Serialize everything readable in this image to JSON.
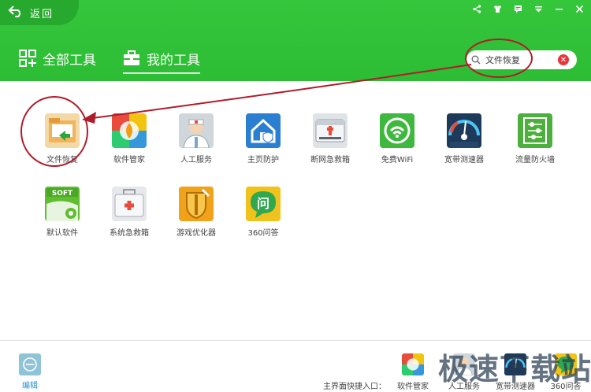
{
  "header": {
    "back_label": "返回",
    "tabs": [
      {
        "label": "全部工具",
        "active": false
      },
      {
        "label": "我的工具",
        "active": true
      }
    ],
    "search_value": "文件恢复"
  },
  "tools": [
    {
      "label": "文件恢复",
      "icon": "file-recovery-icon"
    },
    {
      "label": "软件管家",
      "icon": "software-manager-icon"
    },
    {
      "label": "人工服务",
      "icon": "manual-service-icon"
    },
    {
      "label": "主页防护",
      "icon": "homepage-protect-icon"
    },
    {
      "label": "断网急救箱",
      "icon": "network-first-aid-icon"
    },
    {
      "label": "免费WiFi",
      "icon": "wifi-icon"
    },
    {
      "label": "宽带测速器",
      "icon": "speedometer-icon"
    },
    {
      "label": "流量防火墙",
      "icon": "traffic-firewall-icon"
    },
    {
      "label": "默认软件",
      "icon": "default-software-icon"
    },
    {
      "label": "系统急救箱",
      "icon": "system-first-aid-icon"
    },
    {
      "label": "游戏优化器",
      "icon": "game-optimizer-icon"
    },
    {
      "label": "360问答",
      "icon": "qa-icon"
    }
  ],
  "footer": {
    "edit_label": "编辑",
    "quick_entry_label": "主界面快捷入口：",
    "quick_items": [
      {
        "label": "软件管家"
      },
      {
        "label": "人工服务"
      },
      {
        "label": "宽带测速器"
      },
      {
        "label": "360问答"
      }
    ],
    "watermark": "极速下载站"
  },
  "colors": {
    "header_green": "#2dbd35",
    "annotation_red": "#b01c2a"
  }
}
